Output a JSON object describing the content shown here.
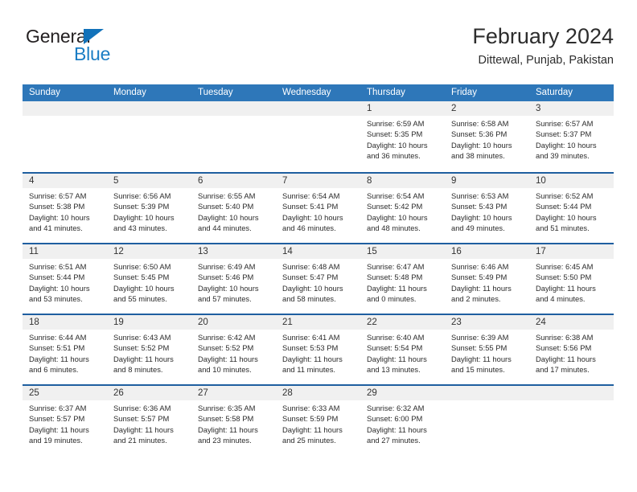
{
  "brand": {
    "word_one": "General",
    "word_two": "Blue",
    "triangle_color": "#1272ba",
    "blue_text_color": "#1a7dc4"
  },
  "header": {
    "title": "February 2024",
    "subtitle": "Dittewal, Punjab, Pakistan"
  },
  "theme": {
    "header_row_bg": "#2e77b9",
    "week_border": "#1f5fa0",
    "daynum_bg": "#f0f0f0"
  },
  "calendar": {
    "weekdays": [
      "Sunday",
      "Monday",
      "Tuesday",
      "Wednesday",
      "Thursday",
      "Friday",
      "Saturday"
    ],
    "weeks": [
      [
        {
          "day": "",
          "lines": []
        },
        {
          "day": "",
          "lines": []
        },
        {
          "day": "",
          "lines": []
        },
        {
          "day": "",
          "lines": []
        },
        {
          "day": "1",
          "lines": [
            "Sunrise: 6:59 AM",
            "Sunset: 5:35 PM",
            "Daylight: 10 hours",
            "and 36 minutes."
          ]
        },
        {
          "day": "2",
          "lines": [
            "Sunrise: 6:58 AM",
            "Sunset: 5:36 PM",
            "Daylight: 10 hours",
            "and 38 minutes."
          ]
        },
        {
          "day": "3",
          "lines": [
            "Sunrise: 6:57 AM",
            "Sunset: 5:37 PM",
            "Daylight: 10 hours",
            "and 39 minutes."
          ]
        }
      ],
      [
        {
          "day": "4",
          "lines": [
            "Sunrise: 6:57 AM",
            "Sunset: 5:38 PM",
            "Daylight: 10 hours",
            "and 41 minutes."
          ]
        },
        {
          "day": "5",
          "lines": [
            "Sunrise: 6:56 AM",
            "Sunset: 5:39 PM",
            "Daylight: 10 hours",
            "and 43 minutes."
          ]
        },
        {
          "day": "6",
          "lines": [
            "Sunrise: 6:55 AM",
            "Sunset: 5:40 PM",
            "Daylight: 10 hours",
            "and 44 minutes."
          ]
        },
        {
          "day": "7",
          "lines": [
            "Sunrise: 6:54 AM",
            "Sunset: 5:41 PM",
            "Daylight: 10 hours",
            "and 46 minutes."
          ]
        },
        {
          "day": "8",
          "lines": [
            "Sunrise: 6:54 AM",
            "Sunset: 5:42 PM",
            "Daylight: 10 hours",
            "and 48 minutes."
          ]
        },
        {
          "day": "9",
          "lines": [
            "Sunrise: 6:53 AM",
            "Sunset: 5:43 PM",
            "Daylight: 10 hours",
            "and 49 minutes."
          ]
        },
        {
          "day": "10",
          "lines": [
            "Sunrise: 6:52 AM",
            "Sunset: 5:44 PM",
            "Daylight: 10 hours",
            "and 51 minutes."
          ]
        }
      ],
      [
        {
          "day": "11",
          "lines": [
            "Sunrise: 6:51 AM",
            "Sunset: 5:44 PM",
            "Daylight: 10 hours",
            "and 53 minutes."
          ]
        },
        {
          "day": "12",
          "lines": [
            "Sunrise: 6:50 AM",
            "Sunset: 5:45 PM",
            "Daylight: 10 hours",
            "and 55 minutes."
          ]
        },
        {
          "day": "13",
          "lines": [
            "Sunrise: 6:49 AM",
            "Sunset: 5:46 PM",
            "Daylight: 10 hours",
            "and 57 minutes."
          ]
        },
        {
          "day": "14",
          "lines": [
            "Sunrise: 6:48 AM",
            "Sunset: 5:47 PM",
            "Daylight: 10 hours",
            "and 58 minutes."
          ]
        },
        {
          "day": "15",
          "lines": [
            "Sunrise: 6:47 AM",
            "Sunset: 5:48 PM",
            "Daylight: 11 hours",
            "and 0 minutes."
          ]
        },
        {
          "day": "16",
          "lines": [
            "Sunrise: 6:46 AM",
            "Sunset: 5:49 PM",
            "Daylight: 11 hours",
            "and 2 minutes."
          ]
        },
        {
          "day": "17",
          "lines": [
            "Sunrise: 6:45 AM",
            "Sunset: 5:50 PM",
            "Daylight: 11 hours",
            "and 4 minutes."
          ]
        }
      ],
      [
        {
          "day": "18",
          "lines": [
            "Sunrise: 6:44 AM",
            "Sunset: 5:51 PM",
            "Daylight: 11 hours",
            "and 6 minutes."
          ]
        },
        {
          "day": "19",
          "lines": [
            "Sunrise: 6:43 AM",
            "Sunset: 5:52 PM",
            "Daylight: 11 hours",
            "and 8 minutes."
          ]
        },
        {
          "day": "20",
          "lines": [
            "Sunrise: 6:42 AM",
            "Sunset: 5:52 PM",
            "Daylight: 11 hours",
            "and 10 minutes."
          ]
        },
        {
          "day": "21",
          "lines": [
            "Sunrise: 6:41 AM",
            "Sunset: 5:53 PM",
            "Daylight: 11 hours",
            "and 11 minutes."
          ]
        },
        {
          "day": "22",
          "lines": [
            "Sunrise: 6:40 AM",
            "Sunset: 5:54 PM",
            "Daylight: 11 hours",
            "and 13 minutes."
          ]
        },
        {
          "day": "23",
          "lines": [
            "Sunrise: 6:39 AM",
            "Sunset: 5:55 PM",
            "Daylight: 11 hours",
            "and 15 minutes."
          ]
        },
        {
          "day": "24",
          "lines": [
            "Sunrise: 6:38 AM",
            "Sunset: 5:56 PM",
            "Daylight: 11 hours",
            "and 17 minutes."
          ]
        }
      ],
      [
        {
          "day": "25",
          "lines": [
            "Sunrise: 6:37 AM",
            "Sunset: 5:57 PM",
            "Daylight: 11 hours",
            "and 19 minutes."
          ]
        },
        {
          "day": "26",
          "lines": [
            "Sunrise: 6:36 AM",
            "Sunset: 5:57 PM",
            "Daylight: 11 hours",
            "and 21 minutes."
          ]
        },
        {
          "day": "27",
          "lines": [
            "Sunrise: 6:35 AM",
            "Sunset: 5:58 PM",
            "Daylight: 11 hours",
            "and 23 minutes."
          ]
        },
        {
          "day": "28",
          "lines": [
            "Sunrise: 6:33 AM",
            "Sunset: 5:59 PM",
            "Daylight: 11 hours",
            "and 25 minutes."
          ]
        },
        {
          "day": "29",
          "lines": [
            "Sunrise: 6:32 AM",
            "Sunset: 6:00 PM",
            "Daylight: 11 hours",
            "and 27 minutes."
          ]
        },
        {
          "day": "",
          "lines": []
        },
        {
          "day": "",
          "lines": []
        }
      ]
    ]
  }
}
